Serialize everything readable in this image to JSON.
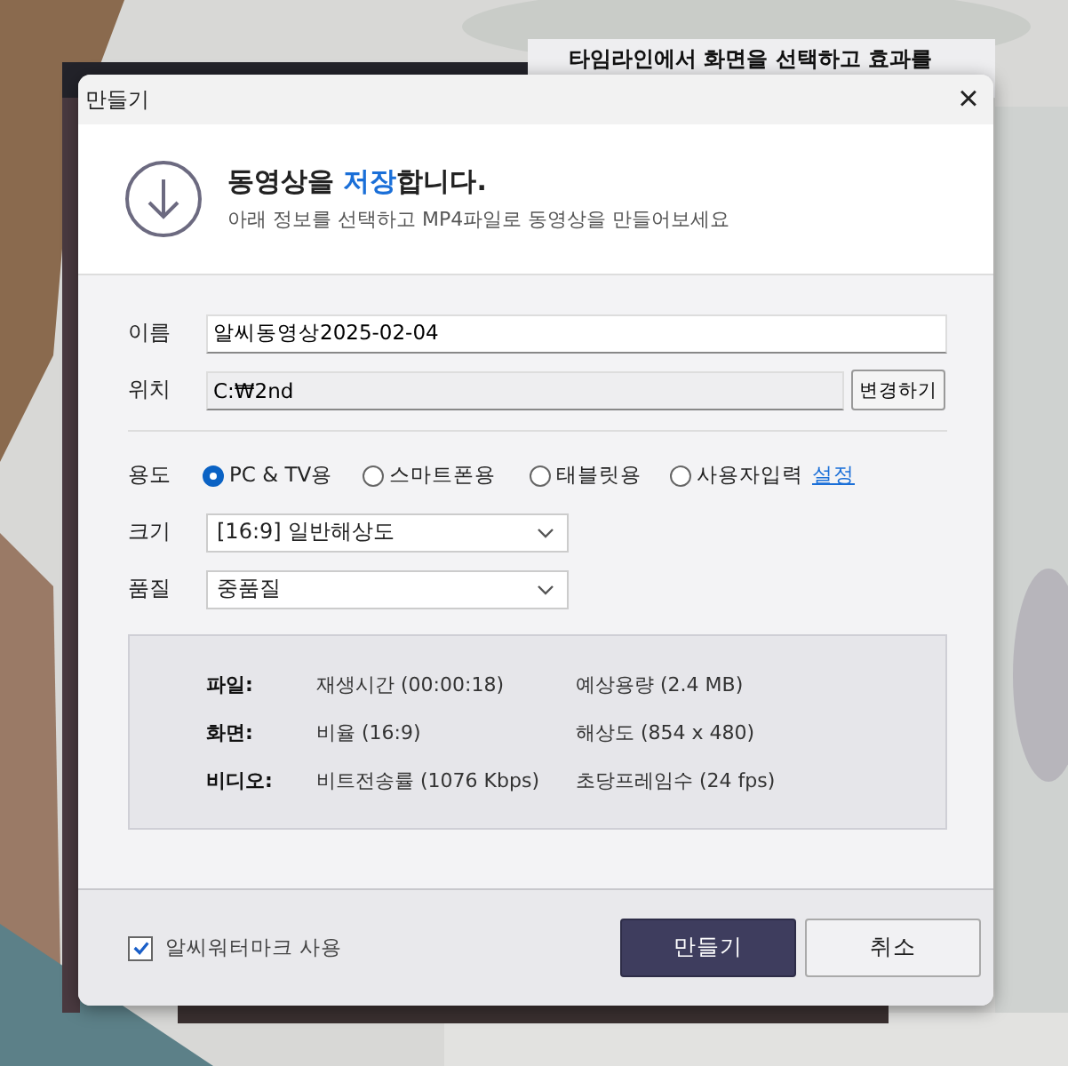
{
  "background_window": {
    "heading": "타임라인에서 화면을 선택하고 효과를"
  },
  "dialog": {
    "title": "만들기",
    "close": "×"
  },
  "header": {
    "title": "동영상을 **저장**합니다.",
    "subtitle": "아래 정보를 선택하고 MP4파일로 동영상을 만들어보세요"
  },
  "name": {
    "label": "이름",
    "value": "알씨동영상2025-02-04"
  },
  "location": {
    "label": "위치",
    "value": "C:₩2nd",
    "button": "변경하기"
  },
  "usage": {
    "label": "용도",
    "options": [
      {
        "label": "PC & TV용",
        "selected": true
      },
      {
        "label": "스마트폰용",
        "selected": false
      },
      {
        "label": "태블릿용",
        "selected": false
      },
      {
        "label": "사용자입력",
        "selected": false
      }
    ],
    "link": "설정"
  },
  "size": {
    "label": "크기",
    "value": "[16:9] 일반해상도"
  },
  "quality": {
    "label": "품질",
    "value": "중품질"
  },
  "info": [
    {
      "label": "파일:",
      "col1": "재생시간 (00:00:18)",
      "col2": "예상용량 (2.4 MB)"
    },
    {
      "label": "화면:",
      "col1": "비율 (16:9)",
      "col2": "해상도 (854 x 480)"
    },
    {
      "label": "비디오:",
      "col1": "비트전송률 (1076 Kbps)",
      "col2": "초당프레임수 (24 fps)"
    }
  ],
  "watermark": {
    "label": "알씨워터마크 사용",
    "checked": true
  },
  "buttons": [
    {
      "label": "만들기",
      "kind": "primary"
    },
    {
      "label": "취소",
      "kind": "secondary"
    }
  ]
}
